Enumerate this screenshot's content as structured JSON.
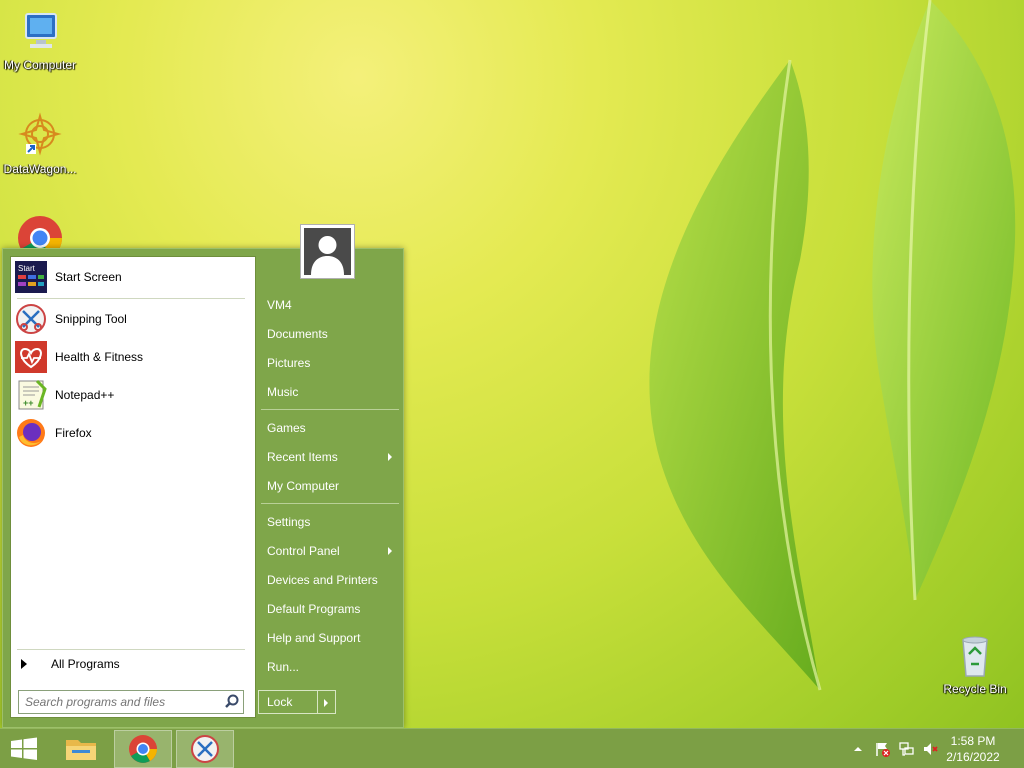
{
  "desktop": {
    "icons": [
      {
        "label": "My Computer",
        "icon": "computer-icon"
      },
      {
        "label": "DataWagon...",
        "icon": "datawagon-icon"
      },
      {
        "label": "Recycle Bin",
        "icon": "recycle-bin-icon"
      }
    ]
  },
  "start_menu": {
    "programs": [
      {
        "label": "Start Screen",
        "icon": "start-screen-icon"
      },
      {
        "label": "Snipping Tool",
        "icon": "snipping-tool-icon"
      },
      {
        "label": "Health & Fitness",
        "icon": "health-fitness-icon"
      },
      {
        "label": "Notepad++",
        "icon": "notepadpp-icon"
      },
      {
        "label": "Firefox",
        "icon": "firefox-icon"
      }
    ],
    "start_screen_icon_text": "Start",
    "all_programs": "All Programs",
    "search_placeholder": "Search programs and files",
    "right_items": [
      {
        "label": "VM4"
      },
      {
        "label": "Documents"
      },
      {
        "label": "Pictures"
      },
      {
        "label": "Music"
      },
      {
        "label": "Games"
      },
      {
        "label": "Recent Items"
      },
      {
        "label": "My Computer"
      },
      {
        "label": "Settings"
      },
      {
        "label": "Control Panel"
      },
      {
        "label": "Devices and Printers"
      },
      {
        "label": "Default Programs"
      },
      {
        "label": "Help and Support"
      },
      {
        "label": "Run..."
      }
    ],
    "lock_label": "Lock"
  },
  "taskbar": {
    "apps": [
      {
        "name": "file-explorer-icon"
      },
      {
        "name": "chrome-icon"
      },
      {
        "name": "snipping-tool-icon"
      }
    ],
    "clock": {
      "time": "1:58 PM",
      "date": "2/16/2022"
    }
  },
  "colors": {
    "menu_green": "#7fa64a",
    "taskbar_green": "#7c9f45"
  }
}
